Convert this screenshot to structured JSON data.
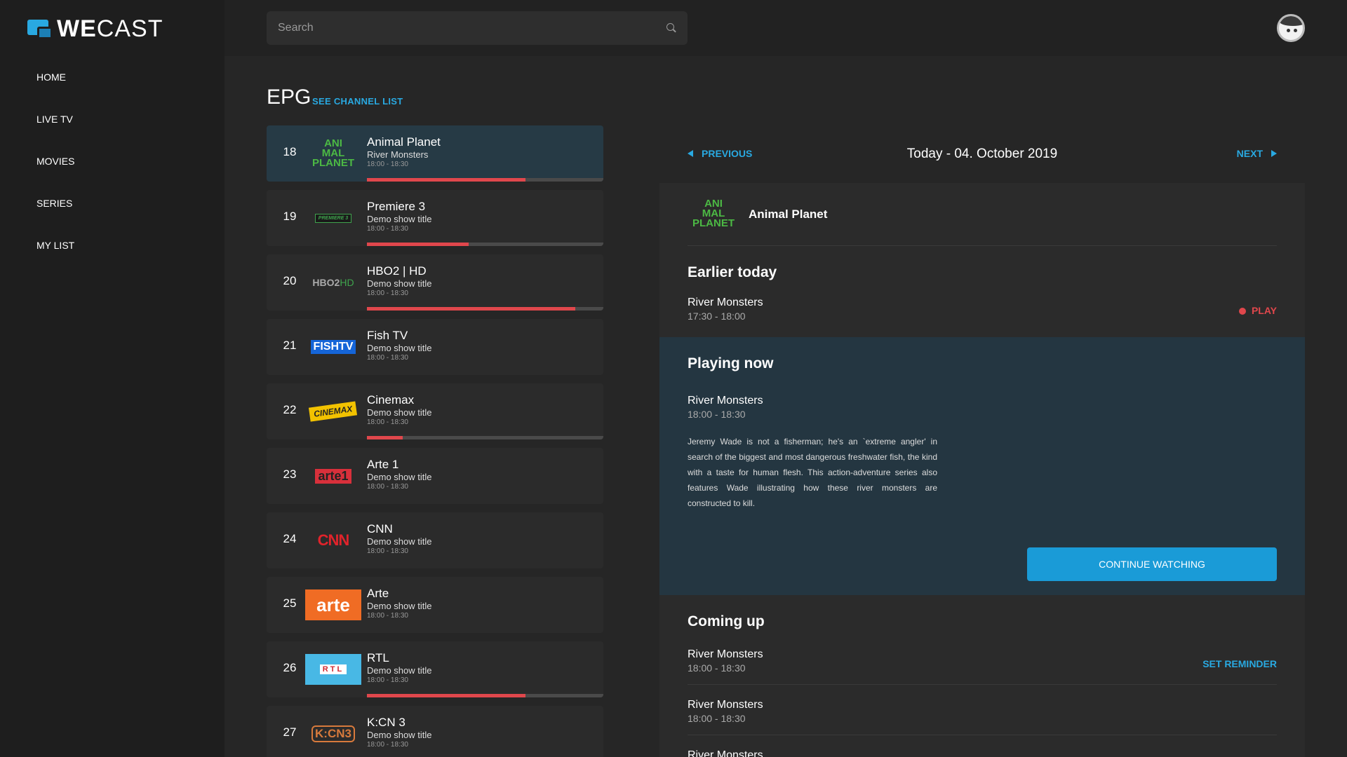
{
  "brand": {
    "logo_bold": "WE",
    "logo_light": "CAST",
    "accent": "#29a9e1"
  },
  "nav": [
    "HOME",
    "LIVE TV",
    "MOVIES",
    "SERIES",
    "MY LIST"
  ],
  "search": {
    "placeholder": "Search"
  },
  "epg": {
    "title": "EPG",
    "see_channels": "SEE CHANNEL LIST"
  },
  "channels": [
    {
      "num": "18",
      "name": "Animal Planet",
      "show": "River Monsters",
      "time": "18:00 - 18:30",
      "logo": "ANIMAL PLANET",
      "progress": 0.67
    },
    {
      "num": "19",
      "name": "Premiere 3",
      "show": "Demo show title",
      "time": "18:00 - 18:30",
      "logo": "PREMIERE 3",
      "progress": 0.43
    },
    {
      "num": "20",
      "name": "HBO2 | HD",
      "show": "Demo show title",
      "time": "18:00 - 18:30",
      "logo": "HBO2HD",
      "progress": 0.88
    },
    {
      "num": "21",
      "name": "Fish TV",
      "show": "Demo show title",
      "time": "18:00 - 18:30",
      "logo": "FISHTV",
      "progress": null
    },
    {
      "num": "22",
      "name": "Cinemax",
      "show": "Demo show title",
      "time": "18:00 - 18:30",
      "logo": "CINEMAX",
      "progress": 0.15
    },
    {
      "num": "23",
      "name": "Arte 1",
      "show": "Demo show title",
      "time": "18:00 - 18:30",
      "logo": "arte1",
      "progress": null
    },
    {
      "num": "24",
      "name": "CNN",
      "show": "Demo show title",
      "time": "18:00 - 18:30",
      "logo": "CNN",
      "progress": null
    },
    {
      "num": "25",
      "name": "Arte",
      "show": "Demo show title",
      "time": "18:00 - 18:30",
      "logo": "arte",
      "progress": null
    },
    {
      "num": "26",
      "name": "RTL",
      "show": "Demo show title",
      "time": "18:00 - 18:30",
      "logo": "RTL",
      "progress": 0.67
    },
    {
      "num": "27",
      "name": "K:CN 3",
      "show": "Demo show title",
      "time": "18:00 - 18:30",
      "logo": "K:CN 3",
      "progress": null
    }
  ],
  "detail": {
    "prev": "PREVIOUS",
    "next": "NEXT",
    "date": "Today - 04. October 2019",
    "channel_name": "Animal Planet",
    "earlier": {
      "title": "Earlier today",
      "show": "River Monsters",
      "time": "17:30 - 18:00",
      "action": "PLAY"
    },
    "now": {
      "title": "Playing now",
      "show": "River Monsters",
      "time": "18:00 - 18:30",
      "description": "Jeremy Wade is not a fisherman; he's an `extreme angler' in search of the biggest and most dangerous freshwater fish, the kind with a taste for human flesh. This action-adventure series also features Wade illustrating how these river monsters are constructed to kill.",
      "action": "CONTINUE WATCHING"
    },
    "coming": {
      "title": "Coming up",
      "items": [
        {
          "show": "River Monsters",
          "time": "18:00 - 18:30",
          "action": "SET REMINDER"
        },
        {
          "show": "River Monsters",
          "time": "18:00 - 18:30"
        },
        {
          "show": "River Monsters",
          "time": ""
        }
      ]
    }
  }
}
